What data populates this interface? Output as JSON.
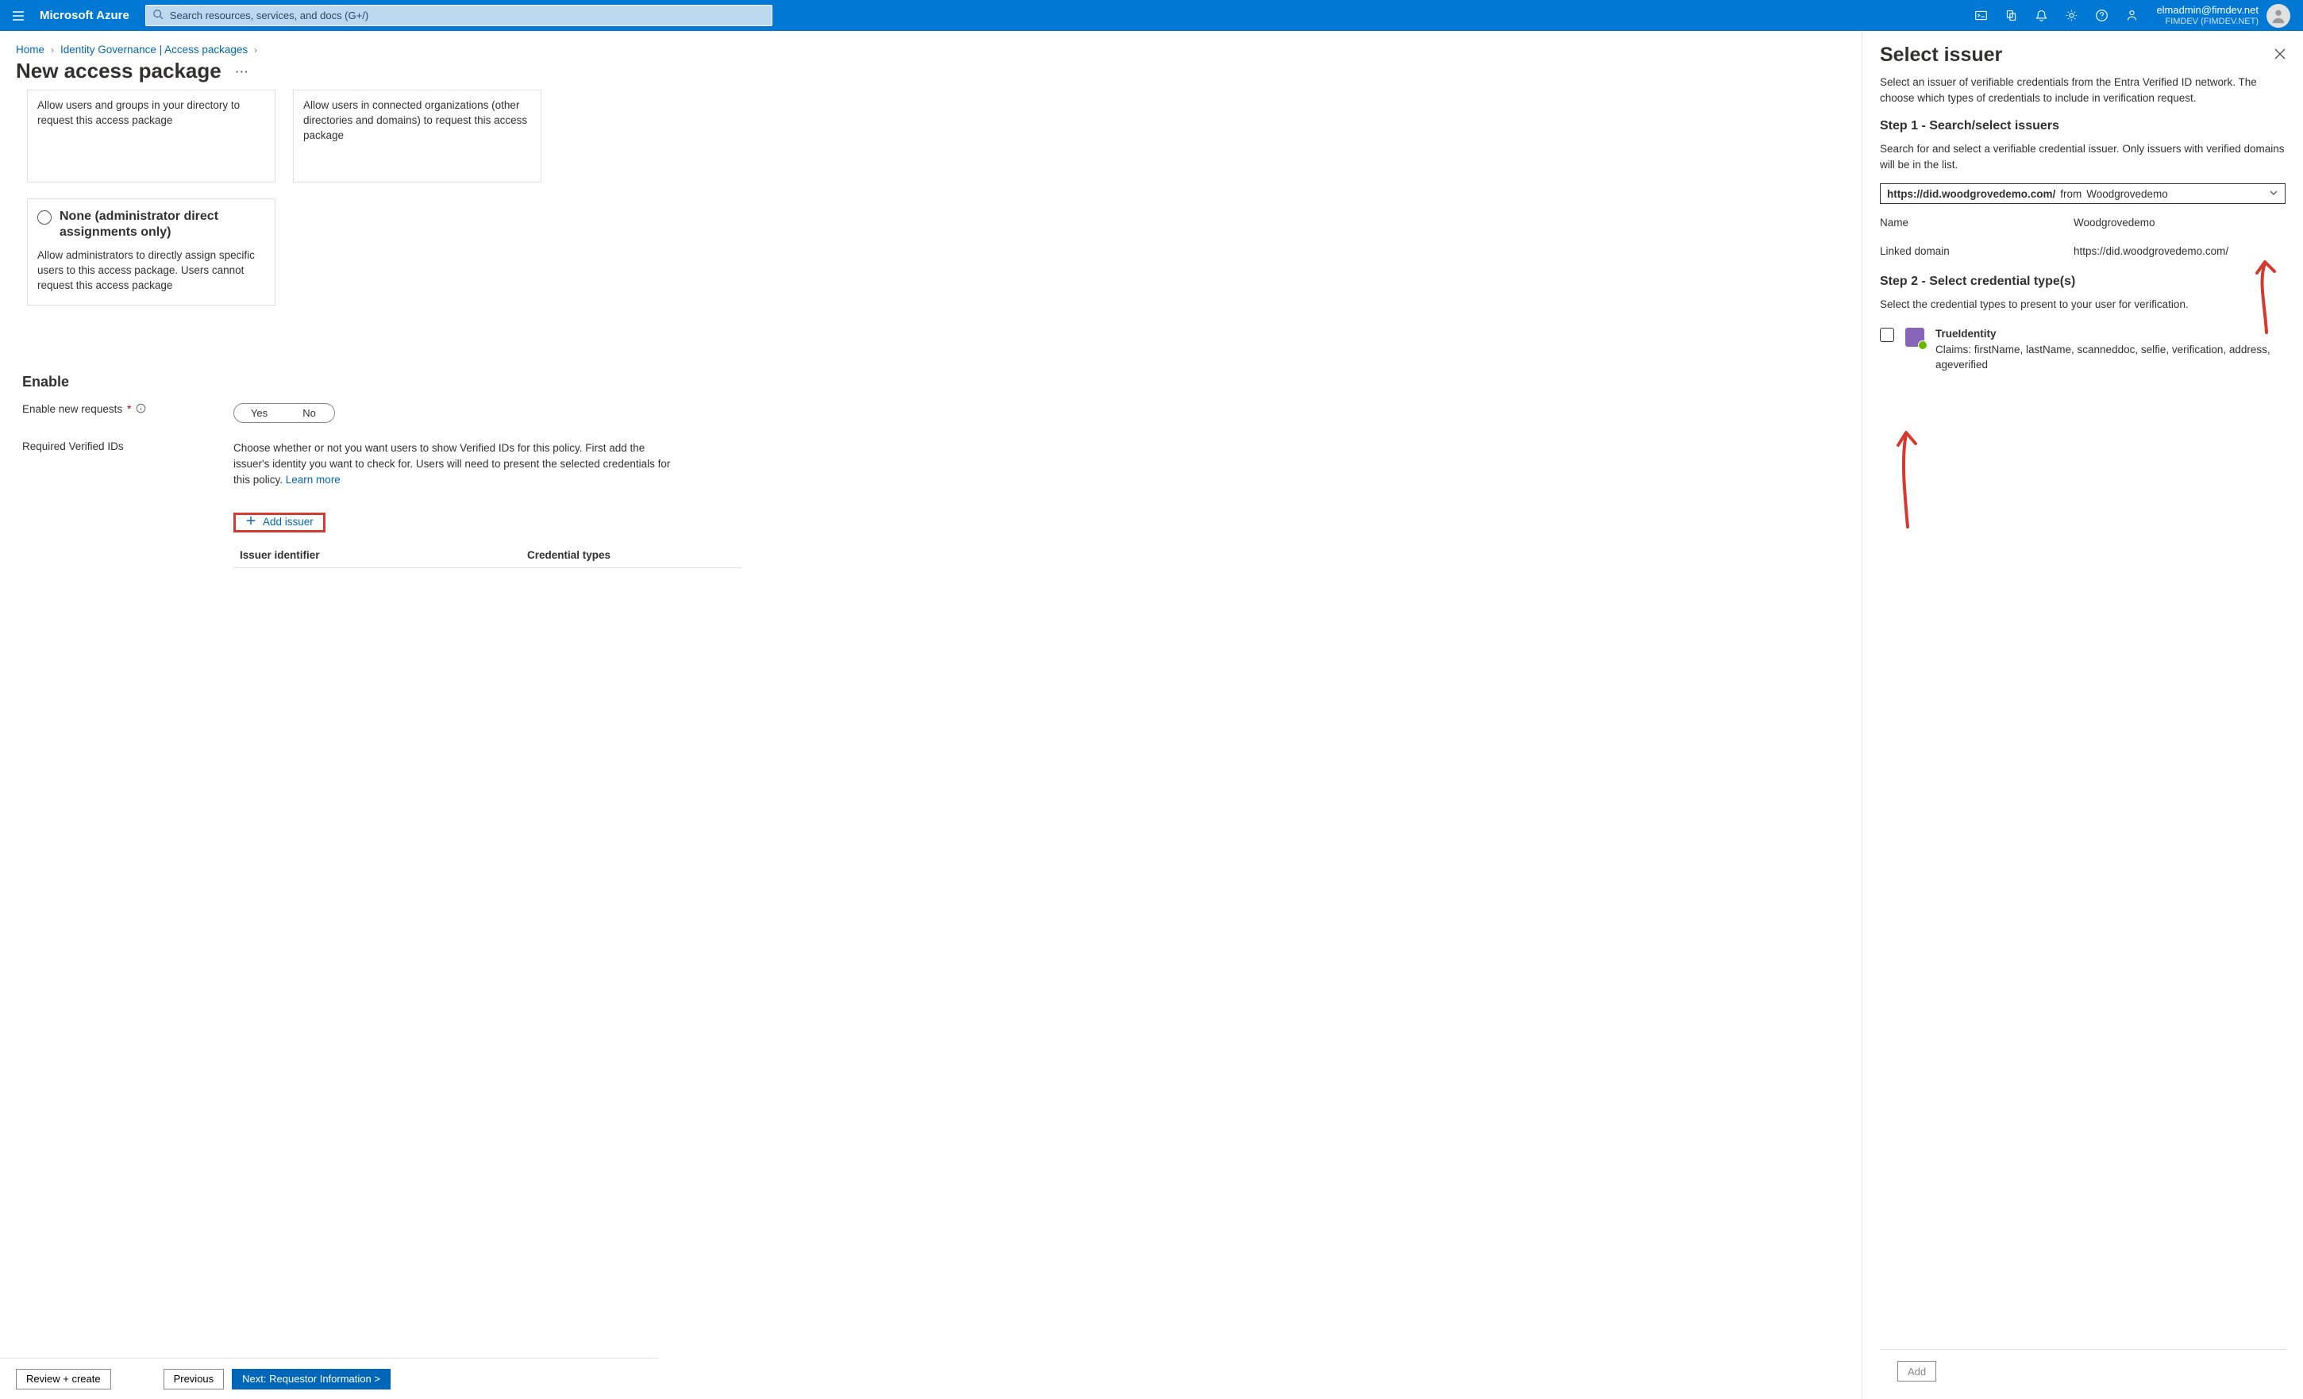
{
  "topbar": {
    "brand": "Microsoft Azure",
    "search_placeholder": "Search resources, services, and docs (G+/)",
    "account": {
      "email": "elmadmin@fimdev.net",
      "tenant": "FIMDEV (FIMDEV.NET)"
    }
  },
  "breadcrumb": {
    "items": [
      "Home",
      "Identity Governance | Access packages"
    ],
    "trailing_chevron": true
  },
  "page_title": "New access package",
  "cards": {
    "left": "Allow users and groups in your directory to request this access package",
    "right": "Allow users in connected organizations (other directories and domains) to request this access package",
    "none": {
      "title": "None (administrator direct assignments only)",
      "desc": "Allow administrators to directly assign specific users to this access package. Users cannot request this access package"
    }
  },
  "enable": {
    "heading": "Enable",
    "new_requests_label": "Enable new requests",
    "toggle_yes": "Yes",
    "toggle_no": "No",
    "req_verifiedids_label": "Required Verified IDs",
    "help_line": "Choose whether or not you want users to show Verified IDs for this policy. First add the issuer's identity you want to check for. Users will need to present the selected credentials for this policy. ",
    "learn_more": "Learn more",
    "add_issuer": "Add issuer",
    "table": {
      "col1": "Issuer identifier",
      "col2": "Credential types"
    }
  },
  "actions": {
    "review": "Review + create",
    "prev": "Previous",
    "next": "Next: Requestor Information >"
  },
  "panel": {
    "title": "Select issuer",
    "intro": "Select an issuer of verifiable credentials from the Entra Verified ID network. The choose which types of credentials to include in verification request.",
    "step1_h": "Step 1 - Search/select issuers",
    "step1_p": "Search for and select a verifiable credential issuer. Only issuers with verified domains will be in the list.",
    "combo": {
      "bold": "https://did.woodgrovedemo.com/",
      "from": "from",
      "org": "Woodgrovedemo"
    },
    "kv": {
      "name_k": "Name",
      "name_v": "Woodgrovedemo",
      "domain_k": "Linked domain",
      "domain_v": "https://did.woodgrovedemo.com/"
    },
    "step2_h": "Step 2 - Select credential type(s)",
    "step2_p": "Select the credential types to present to your user for verification.",
    "cred": {
      "title": "TrueIdentity",
      "claims": "Claims: firstName, lastName, scanneddoc, selfie, verification, address, ageverified"
    },
    "add": "Add"
  }
}
